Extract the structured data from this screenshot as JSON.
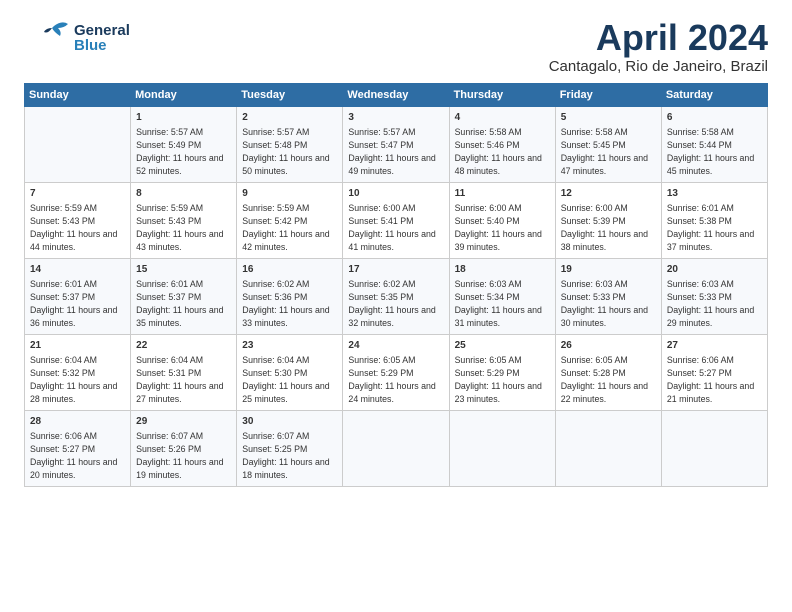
{
  "header": {
    "logo_general": "General",
    "logo_blue": "Blue",
    "month_title": "April 2024",
    "location": "Cantagalo, Rio de Janeiro, Brazil"
  },
  "days_of_week": [
    "Sunday",
    "Monday",
    "Tuesday",
    "Wednesday",
    "Thursday",
    "Friday",
    "Saturday"
  ],
  "weeks": [
    [
      {
        "day": "",
        "sunrise": "",
        "sunset": "",
        "daylight": ""
      },
      {
        "day": "1",
        "sunrise": "Sunrise: 5:57 AM",
        "sunset": "Sunset: 5:49 PM",
        "daylight": "Daylight: 11 hours and 52 minutes."
      },
      {
        "day": "2",
        "sunrise": "Sunrise: 5:57 AM",
        "sunset": "Sunset: 5:48 PM",
        "daylight": "Daylight: 11 hours and 50 minutes."
      },
      {
        "day": "3",
        "sunrise": "Sunrise: 5:57 AM",
        "sunset": "Sunset: 5:47 PM",
        "daylight": "Daylight: 11 hours and 49 minutes."
      },
      {
        "day": "4",
        "sunrise": "Sunrise: 5:58 AM",
        "sunset": "Sunset: 5:46 PM",
        "daylight": "Daylight: 11 hours and 48 minutes."
      },
      {
        "day": "5",
        "sunrise": "Sunrise: 5:58 AM",
        "sunset": "Sunset: 5:45 PM",
        "daylight": "Daylight: 11 hours and 47 minutes."
      },
      {
        "day": "6",
        "sunrise": "Sunrise: 5:58 AM",
        "sunset": "Sunset: 5:44 PM",
        "daylight": "Daylight: 11 hours and 45 minutes."
      }
    ],
    [
      {
        "day": "7",
        "sunrise": "Sunrise: 5:59 AM",
        "sunset": "Sunset: 5:43 PM",
        "daylight": "Daylight: 11 hours and 44 minutes."
      },
      {
        "day": "8",
        "sunrise": "Sunrise: 5:59 AM",
        "sunset": "Sunset: 5:43 PM",
        "daylight": "Daylight: 11 hours and 43 minutes."
      },
      {
        "day": "9",
        "sunrise": "Sunrise: 5:59 AM",
        "sunset": "Sunset: 5:42 PM",
        "daylight": "Daylight: 11 hours and 42 minutes."
      },
      {
        "day": "10",
        "sunrise": "Sunrise: 6:00 AM",
        "sunset": "Sunset: 5:41 PM",
        "daylight": "Daylight: 11 hours and 41 minutes."
      },
      {
        "day": "11",
        "sunrise": "Sunrise: 6:00 AM",
        "sunset": "Sunset: 5:40 PM",
        "daylight": "Daylight: 11 hours and 39 minutes."
      },
      {
        "day": "12",
        "sunrise": "Sunrise: 6:00 AM",
        "sunset": "Sunset: 5:39 PM",
        "daylight": "Daylight: 11 hours and 38 minutes."
      },
      {
        "day": "13",
        "sunrise": "Sunrise: 6:01 AM",
        "sunset": "Sunset: 5:38 PM",
        "daylight": "Daylight: 11 hours and 37 minutes."
      }
    ],
    [
      {
        "day": "14",
        "sunrise": "Sunrise: 6:01 AM",
        "sunset": "Sunset: 5:37 PM",
        "daylight": "Daylight: 11 hours and 36 minutes."
      },
      {
        "day": "15",
        "sunrise": "Sunrise: 6:01 AM",
        "sunset": "Sunset: 5:37 PM",
        "daylight": "Daylight: 11 hours and 35 minutes."
      },
      {
        "day": "16",
        "sunrise": "Sunrise: 6:02 AM",
        "sunset": "Sunset: 5:36 PM",
        "daylight": "Daylight: 11 hours and 33 minutes."
      },
      {
        "day": "17",
        "sunrise": "Sunrise: 6:02 AM",
        "sunset": "Sunset: 5:35 PM",
        "daylight": "Daylight: 11 hours and 32 minutes."
      },
      {
        "day": "18",
        "sunrise": "Sunrise: 6:03 AM",
        "sunset": "Sunset: 5:34 PM",
        "daylight": "Daylight: 11 hours and 31 minutes."
      },
      {
        "day": "19",
        "sunrise": "Sunrise: 6:03 AM",
        "sunset": "Sunset: 5:33 PM",
        "daylight": "Daylight: 11 hours and 30 minutes."
      },
      {
        "day": "20",
        "sunrise": "Sunrise: 6:03 AM",
        "sunset": "Sunset: 5:33 PM",
        "daylight": "Daylight: 11 hours and 29 minutes."
      }
    ],
    [
      {
        "day": "21",
        "sunrise": "Sunrise: 6:04 AM",
        "sunset": "Sunset: 5:32 PM",
        "daylight": "Daylight: 11 hours and 28 minutes."
      },
      {
        "day": "22",
        "sunrise": "Sunrise: 6:04 AM",
        "sunset": "Sunset: 5:31 PM",
        "daylight": "Daylight: 11 hours and 27 minutes."
      },
      {
        "day": "23",
        "sunrise": "Sunrise: 6:04 AM",
        "sunset": "Sunset: 5:30 PM",
        "daylight": "Daylight: 11 hours and 25 minutes."
      },
      {
        "day": "24",
        "sunrise": "Sunrise: 6:05 AM",
        "sunset": "Sunset: 5:29 PM",
        "daylight": "Daylight: 11 hours and 24 minutes."
      },
      {
        "day": "25",
        "sunrise": "Sunrise: 6:05 AM",
        "sunset": "Sunset: 5:29 PM",
        "daylight": "Daylight: 11 hours and 23 minutes."
      },
      {
        "day": "26",
        "sunrise": "Sunrise: 6:05 AM",
        "sunset": "Sunset: 5:28 PM",
        "daylight": "Daylight: 11 hours and 22 minutes."
      },
      {
        "day": "27",
        "sunrise": "Sunrise: 6:06 AM",
        "sunset": "Sunset: 5:27 PM",
        "daylight": "Daylight: 11 hours and 21 minutes."
      }
    ],
    [
      {
        "day": "28",
        "sunrise": "Sunrise: 6:06 AM",
        "sunset": "Sunset: 5:27 PM",
        "daylight": "Daylight: 11 hours and 20 minutes."
      },
      {
        "day": "29",
        "sunrise": "Sunrise: 6:07 AM",
        "sunset": "Sunset: 5:26 PM",
        "daylight": "Daylight: 11 hours and 19 minutes."
      },
      {
        "day": "30",
        "sunrise": "Sunrise: 6:07 AM",
        "sunset": "Sunset: 5:25 PM",
        "daylight": "Daylight: 11 hours and 18 minutes."
      },
      {
        "day": "",
        "sunrise": "",
        "sunset": "",
        "daylight": ""
      },
      {
        "day": "",
        "sunrise": "",
        "sunset": "",
        "daylight": ""
      },
      {
        "day": "",
        "sunrise": "",
        "sunset": "",
        "daylight": ""
      },
      {
        "day": "",
        "sunrise": "",
        "sunset": "",
        "daylight": ""
      }
    ]
  ]
}
